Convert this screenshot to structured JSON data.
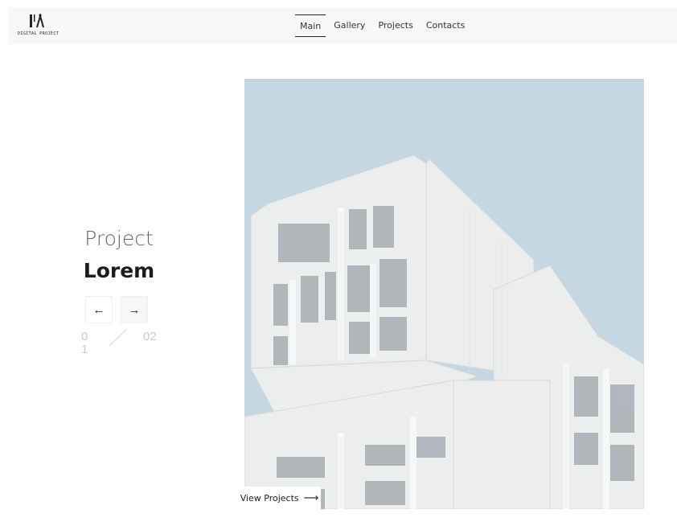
{
  "logo": {
    "text": "DIGITAL PROJECT"
  },
  "nav": {
    "items": [
      "Main",
      "Gallery",
      "Projects",
      "Contacts"
    ],
    "active": "Main"
  },
  "hero": {
    "title_light": "Project",
    "title_bold": "Lorem",
    "prev_arrow": "←",
    "next_arrow": "→",
    "counter_current": "01",
    "counter_total": "02",
    "cta_label": "View Projects",
    "cta_arrow": "⟶"
  },
  "colors": {
    "sky": "#c5d7e3",
    "building": "#eceeee",
    "navbar_bg": "#f7f8f9"
  },
  "icons": {
    "logo": "logo-mark-icon",
    "prev": "arrow-left-icon",
    "next": "arrow-right-icon",
    "cta": "arrow-right-long-icon"
  }
}
